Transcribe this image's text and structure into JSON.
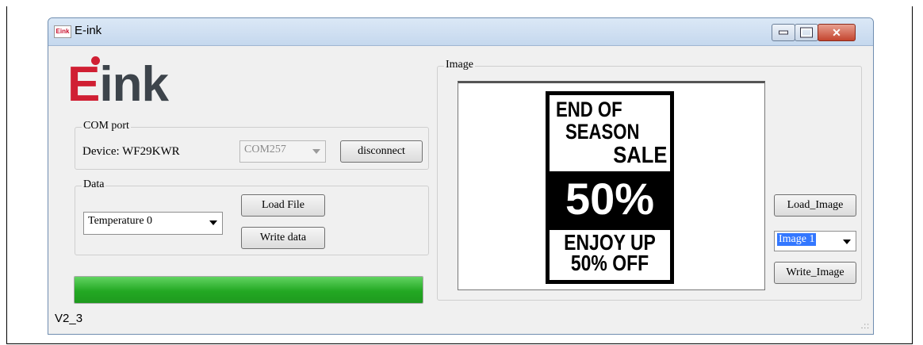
{
  "window": {
    "title": "E-ink",
    "app_icon_text": "Eink"
  },
  "logo": {
    "first_letter": "E",
    "rest": "ink"
  },
  "com_port": {
    "legend": "COM port",
    "device_label": "Device: WF29KWR",
    "port_value": "COM257",
    "disconnect_label": "disconnect"
  },
  "data_group": {
    "legend": "Data",
    "temperature_value": "Temperature 0",
    "load_file_label": "Load File",
    "write_data_label": "Write data"
  },
  "progress": {
    "fraction": 1.0
  },
  "version": "V2_3",
  "image_group": {
    "legend": "Image",
    "load_image_label": "Load_Image",
    "image_select_value": "Image 1",
    "write_image_label": "Write_Image"
  },
  "poster": {
    "line1": "END OF",
    "line2": "SEASON",
    "line3": "SALE",
    "line4": "50%",
    "line5": "ENJOY UP",
    "line6": "50% OFF"
  },
  "colors": {
    "logo_red": "#d01f33",
    "logo_gray": "#3d444b",
    "progress_green": "#23a823"
  }
}
